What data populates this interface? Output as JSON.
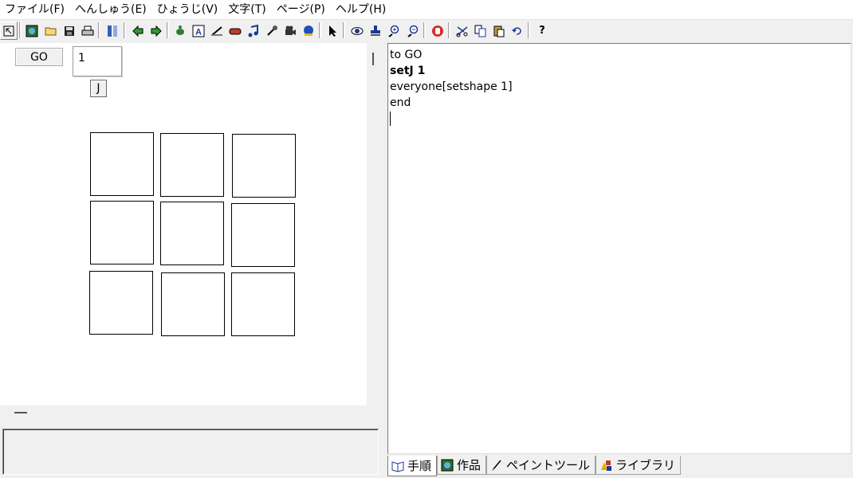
{
  "menu": [
    "ファイル(F)",
    "へんしゅう(E)",
    "ひょうじ(V)",
    "文字(T)",
    "ページ(P)",
    "ヘルプ(H)"
  ],
  "toolbar": {
    "help_label": "?",
    "text_tool_label": "A"
  },
  "canvas": {
    "go_button_label": "GO",
    "value_box_text": "1",
    "j_button_label": "J"
  },
  "editor": {
    "lines": [
      "to GO",
      "setJ 1",
      "everyone[setshape 1]",
      "end"
    ]
  },
  "tabs": [
    "手順",
    "作品",
    "ペイントツール",
    "ライブラリ"
  ]
}
